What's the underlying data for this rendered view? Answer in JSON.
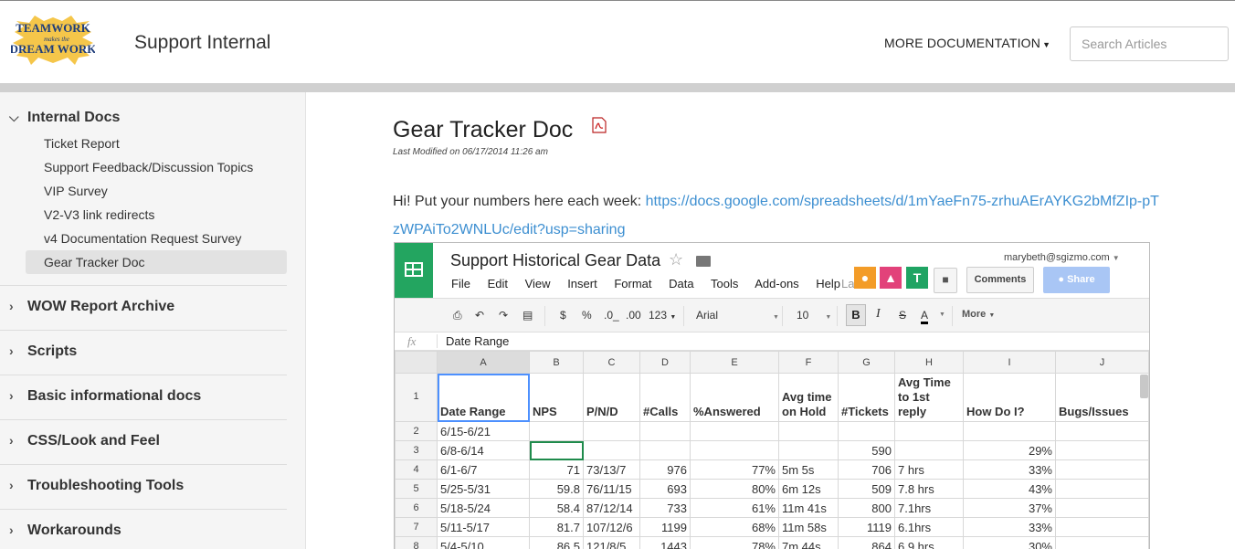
{
  "header": {
    "logo_text": [
      "TEAMWORK",
      "makes the",
      "DREAM WORK"
    ],
    "site_title": "Support Internal",
    "more_docs": "MORE DOCUMENTATION",
    "search_placeholder": "Search Articles"
  },
  "sidebar": {
    "sections": [
      {
        "label": "Internal Docs",
        "expanded": true
      },
      {
        "label": "WOW Report Archive",
        "expanded": false
      },
      {
        "label": "Scripts",
        "expanded": false
      },
      {
        "label": "Basic informational docs",
        "expanded": false
      },
      {
        "label": "CSS/Look and Feel",
        "expanded": false
      },
      {
        "label": "Troubleshooting Tools",
        "expanded": false
      },
      {
        "label": "Workarounds",
        "expanded": false
      }
    ],
    "items": [
      "Ticket Report",
      "Support Feedback/Discussion Topics",
      "VIP Survey",
      "V2-V3 link redirects",
      "v4 Documentation Request Survey",
      "Gear Tracker Doc"
    ],
    "active_item": "Gear Tracker Doc"
  },
  "article": {
    "title": "Gear Tracker Doc",
    "modified": "Last Modified on 06/17/2014 11:26 am",
    "intro_text": "Hi! Put your numbers here each week: ",
    "link": "https://docs.google.com/spreadsheets/d/1mYaeFn75-zrhuAErAYKG2bMfZIp-pTzWPAiTo2WNLUc/edit?usp=sharing"
  },
  "sheet": {
    "title": "Support Historical Gear Data",
    "user_email": "marybeth@sgizmo.com",
    "menus": [
      "File",
      "Edit",
      "View",
      "Insert",
      "Format",
      "Data",
      "Tools",
      "Add-ons",
      "Help"
    ],
    "last_edit": "La",
    "comments_label": "Comments",
    "share_label": "Share",
    "avatars": [
      {
        "letter": "",
        "color": "#f39c28"
      },
      {
        "letter": "",
        "color": "#e2427a"
      },
      {
        "letter": "T",
        "color": "#1fa463"
      }
    ],
    "toolbar": {
      "currency": "$",
      "percent": "%",
      "dec_less": ".0_",
      "dec_more": ".00",
      "format_more": "123",
      "font": "Arial",
      "size": "10",
      "bold": "B",
      "italic": "I",
      "strike": "S",
      "text_color": "A",
      "more": "More"
    },
    "formula_bar": {
      "fx": "fx",
      "value": "Date Range"
    },
    "columns": [
      "A",
      "B",
      "C",
      "D",
      "E",
      "F",
      "G",
      "H",
      "I",
      "J"
    ],
    "header_row": [
      "Date Range",
      "NPS",
      "P/N/D",
      "#Calls",
      "%Answered",
      "Avg time on Hold",
      "#Tickets",
      "Avg Time to 1st reply",
      "How Do I?",
      "Bugs/Issues"
    ],
    "rows": [
      {
        "n": "2",
        "cells": [
          "6/15-6/21",
          "",
          "",
          "",
          "",
          "",
          "",
          "",
          "",
          ""
        ]
      },
      {
        "n": "3",
        "cells": [
          "6/8-6/14",
          "",
          "",
          "",
          "",
          "",
          "590",
          "",
          "29%",
          ""
        ]
      },
      {
        "n": "4",
        "cells": [
          "6/1-6/7",
          "71",
          "73/13/7",
          "976",
          "77%",
          "5m 5s",
          "706",
          "7 hrs",
          "33%",
          ""
        ]
      },
      {
        "n": "5",
        "cells": [
          "5/25-5/31",
          "59.8",
          "76/11/15",
          "693",
          "80%",
          "6m 12s",
          "509",
          "7.8 hrs",
          "43%",
          ""
        ]
      },
      {
        "n": "6",
        "cells": [
          "5/18-5/24",
          "58.4",
          "87/12/14",
          "733",
          "61%",
          "11m 41s",
          "800",
          "7.1hrs",
          "37%",
          ""
        ]
      },
      {
        "n": "7",
        "cells": [
          "5/11-5/17",
          "81.7",
          "107/12/6",
          "1199",
          "68%",
          "11m 58s",
          "1119",
          "6.1hrs",
          "33%",
          ""
        ]
      },
      {
        "n": "8",
        "cells": [
          "5/4-5/10",
          "86.5",
          "121/8/5",
          "1443",
          "78%",
          "7m 44s",
          "864",
          "6.9 hrs",
          "30%",
          ""
        ]
      }
    ]
  }
}
